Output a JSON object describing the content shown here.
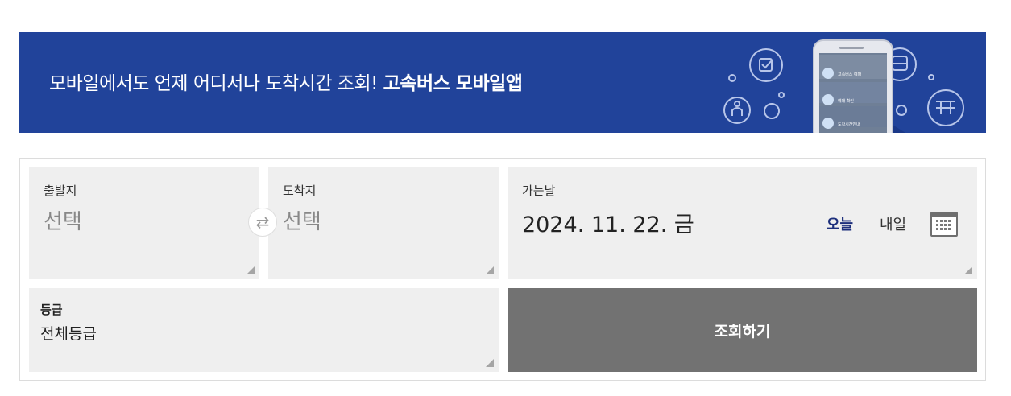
{
  "banner": {
    "text_normal": "모바일에서도 언제 어디서나 도착시간 조회! ",
    "text_bold": "고속버스 모바일앱",
    "phone_menu": [
      "고속버스 예매",
      "예매 확인",
      "도착시간안내"
    ],
    "background_color": "#21439a"
  },
  "search": {
    "departure": {
      "label": "출발지",
      "value": "선택"
    },
    "swap_icon": "⇄",
    "arrival": {
      "label": "도착지",
      "value": "선택"
    },
    "date": {
      "label": "가는날",
      "value": "2024. 11. 22. 금",
      "today": "오늘",
      "tomorrow": "내일"
    },
    "grade": {
      "label": "등급",
      "value": "전체등급"
    },
    "submit_label": "조회하기",
    "button_color": "#727272"
  }
}
